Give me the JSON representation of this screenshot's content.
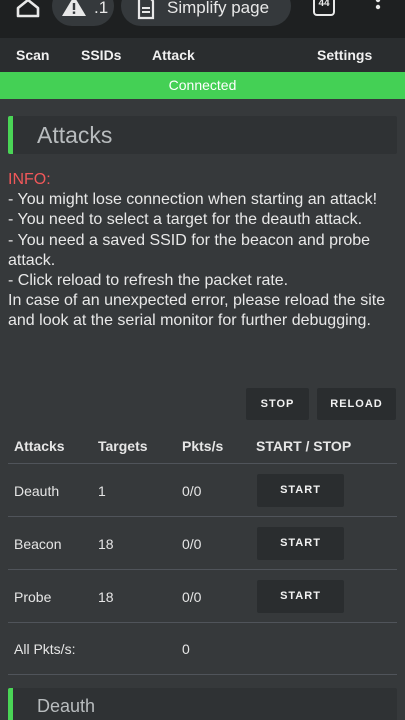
{
  "browser": {
    "alert_badge": ".1",
    "simplify_label": "Simplify page",
    "tab_count": "44"
  },
  "nav": {
    "items": [
      "Scan",
      "SSIDs",
      "Attack",
      "Settings"
    ]
  },
  "status": "Connected",
  "attacks_card": {
    "title": "Attacks"
  },
  "info": {
    "title": "INFO:",
    "lines": [
      "- You might lose connection when starting an attack!",
      "- You need to select a target for the deauth attack.",
      "- You need a saved SSID for the beacon and probe attack.",
      "- Click reload to refresh the packet rate.",
      "In case of an unexpected error, please reload the site and look at the serial monitor for further debugging."
    ]
  },
  "controls": {
    "stop_label": "STOP",
    "reload_label": "RELOAD"
  },
  "table": {
    "headers": [
      "Attacks",
      "Targets",
      "Pkts/s",
      "START / STOP"
    ],
    "rows": [
      {
        "attack": "Deauth",
        "targets": "1",
        "pkts": "0/0",
        "button": "START"
      },
      {
        "attack": "Beacon",
        "targets": "18",
        "pkts": "0/0",
        "button": "START"
      },
      {
        "attack": "Probe",
        "targets": "18",
        "pkts": "0/0",
        "button": "START"
      }
    ],
    "total_label": "All Pkts/s:",
    "total_value": "0"
  },
  "deauth_card": {
    "title": "Deauth"
  },
  "colors": {
    "accent": "#44d055",
    "info_title": "#f0585a",
    "background": "#36393b"
  }
}
